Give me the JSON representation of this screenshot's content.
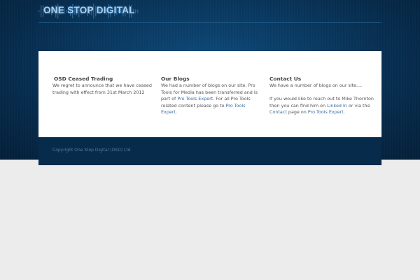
{
  "header": {
    "logo_text": "ONE STOP DIGITAL"
  },
  "columns": {
    "ceased": {
      "title": "OSD Ceased Trading",
      "body": "We regret to announce that we have ceased trading with effect from 31st March 2012"
    },
    "blogs": {
      "title": "Our Blogs",
      "text_1": "We had a number of blogs on our site.  Pro Tools for Media has been transferred and is part of ",
      "link_1": "Pro Tools Expert",
      "text_2": ". For all Pro Tools related content please go to ",
      "link_2": "Pro Tools Expert",
      "text_3": "."
    },
    "contact": {
      "title": "Contact Us",
      "line_1": "We have a number of blogs on our site....",
      "text_1": "If you would like to reach out to Mike Thornton then you can find him on ",
      "link_1": "Linked In",
      "text_2": " or via the ",
      "link_2": "Contact",
      "text_3": " page on ",
      "link_3": "Pro Tools Expert",
      "text_4": "."
    }
  },
  "footer": {
    "copyright": "Copyright One Stop Digital (OSD) Ltd"
  },
  "icons": {
    "logo": "audio-waveform-icon"
  },
  "colors": {
    "background": "#ececec",
    "hero": "#093a63",
    "panel": "#ffffff",
    "footer": "#072b4a",
    "link": "#3a6da3"
  }
}
